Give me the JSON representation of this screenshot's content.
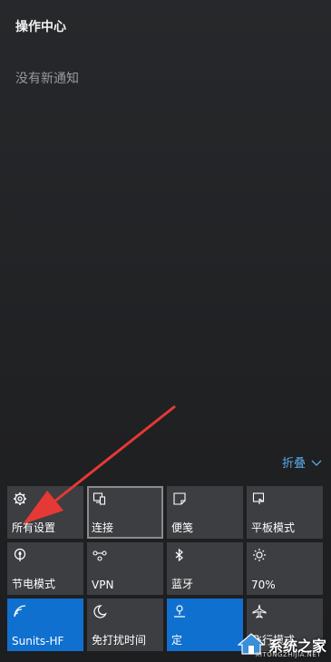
{
  "header": {
    "title": "操作中心"
  },
  "notifications": {
    "empty_text": "没有新通知"
  },
  "collapse": {
    "label": "折叠"
  },
  "tiles": [
    {
      "label": "所有设置",
      "icon": "gear-icon",
      "state": "normal"
    },
    {
      "label": "连接",
      "icon": "connect-icon",
      "state": "focused"
    },
    {
      "label": "便笺",
      "icon": "note-icon",
      "state": "normal"
    },
    {
      "label": "平板模式",
      "icon": "tablet-mode-icon",
      "state": "normal"
    },
    {
      "label": "节电模式",
      "icon": "battery-saver-icon",
      "state": "normal"
    },
    {
      "label": "VPN",
      "icon": "vpn-icon",
      "state": "normal"
    },
    {
      "label": "蓝牙",
      "icon": "bluetooth-icon",
      "state": "normal"
    },
    {
      "label": "70%",
      "icon": "brightness-icon",
      "state": "normal"
    },
    {
      "label": "Sunits-HF",
      "icon": "wifi-icon",
      "state": "on"
    },
    {
      "label": "免打扰时间",
      "icon": "moon-icon",
      "state": "normal"
    },
    {
      "label": "定",
      "icon": "location-icon",
      "state": "on"
    },
    {
      "label": "飞行模式",
      "icon": "airplane-icon",
      "state": "normal"
    }
  ],
  "watermark": {
    "text": "系统之家",
    "sub": "XITONGZHIJIA.NET"
  },
  "colors": {
    "accent": "#1070cf",
    "tile": "#3c3e41",
    "background": "#1f2022",
    "link": "#5aa9e8",
    "arrow": "#e53935"
  }
}
